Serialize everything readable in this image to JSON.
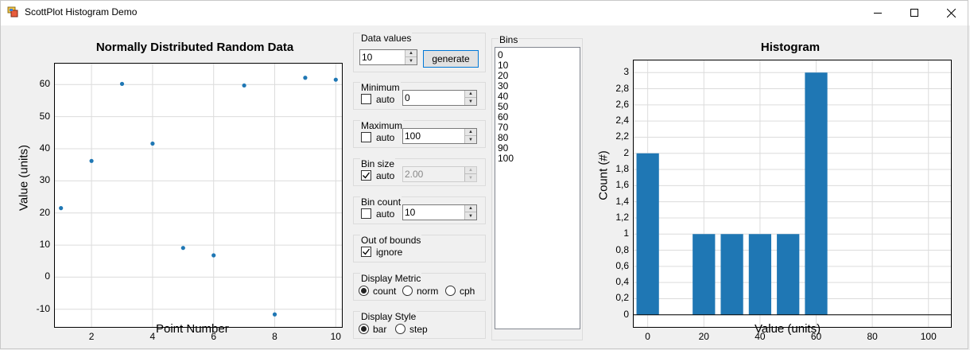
{
  "window": {
    "title": "ScottPlot Histogram Demo",
    "minimize_icon": "minimize-icon",
    "maximize_icon": "maximize-icon",
    "close_icon": "close-icon"
  },
  "controls": {
    "data_values": {
      "label": "Data values",
      "value": "10",
      "generate_label": "generate"
    },
    "minimum": {
      "label": "Minimum",
      "auto_label": "auto",
      "auto_checked": false,
      "value": "0"
    },
    "maximum": {
      "label": "Maximum",
      "auto_label": "auto",
      "auto_checked": false,
      "value": "100"
    },
    "bin_size": {
      "label": "Bin size",
      "auto_label": "auto",
      "auto_checked": true,
      "value": "2.00",
      "disabled": true
    },
    "bin_count": {
      "label": "Bin count",
      "auto_label": "auto",
      "auto_checked": false,
      "value": "10"
    },
    "out_of_bounds": {
      "label": "Out of bounds",
      "ignore_label": "ignore",
      "ignore_checked": true
    },
    "display_metric": {
      "label": "Display Metric",
      "options": [
        "count",
        "norm",
        "cph"
      ],
      "selected": "count"
    },
    "display_style": {
      "label": "Display Style",
      "options": [
        "bar",
        "step"
      ],
      "selected": "bar"
    }
  },
  "bins": {
    "label": "Bins",
    "items": [
      "0",
      "10",
      "20",
      "30",
      "40",
      "50",
      "60",
      "70",
      "80",
      "90",
      "100"
    ]
  },
  "chart_data": [
    {
      "type": "scatter",
      "title": "Normally Distributed Random Data",
      "xlabel": "Point Number",
      "ylabel": "Value (units)",
      "x": [
        1,
        2,
        3,
        4,
        5,
        6,
        7,
        8,
        9,
        10
      ],
      "y": [
        21.5,
        36.2,
        60.2,
        41.6,
        9.1,
        6.8,
        59.7,
        -11.6,
        62.1,
        61.5
      ],
      "xlim": [
        0.8,
        10.2
      ],
      "ylim": [
        -15.5,
        66.5
      ],
      "xticks": [
        2,
        4,
        6,
        8,
        10
      ],
      "yticks": [
        -10,
        0,
        10,
        20,
        30,
        40,
        50,
        60
      ],
      "color": "#1f77b4",
      "grid": true
    },
    {
      "type": "bar",
      "title": "Histogram",
      "xlabel": "Value (units)",
      "ylabel": "Count (#)",
      "bin_starts": [
        0,
        10,
        20,
        30,
        40,
        50,
        60,
        70,
        80,
        90
      ],
      "bin_width": 10,
      "values": [
        2,
        0,
        1,
        1,
        1,
        1,
        3,
        0,
        0,
        0
      ],
      "xlim": [
        -5,
        108
      ],
      "ylim": [
        -0.15,
        3.15
      ],
      "xticks": [
        0,
        20,
        40,
        60,
        80,
        100
      ],
      "yticks": [
        0,
        0.2,
        0.4,
        0.6,
        0.8,
        1,
        1.2,
        1.4,
        1.6,
        1.8,
        2,
        2.2,
        2.4,
        2.6,
        2.8,
        3
      ],
      "ytick_labels": [
        "0",
        "0,2",
        "0,4",
        "0,6",
        "0,8",
        "1",
        "1,2",
        "1,4",
        "1,6",
        "1,8",
        "2",
        "2,2",
        "2,4",
        "2,6",
        "2,8",
        "3"
      ],
      "color": "#1f77b4",
      "grid": true
    }
  ]
}
